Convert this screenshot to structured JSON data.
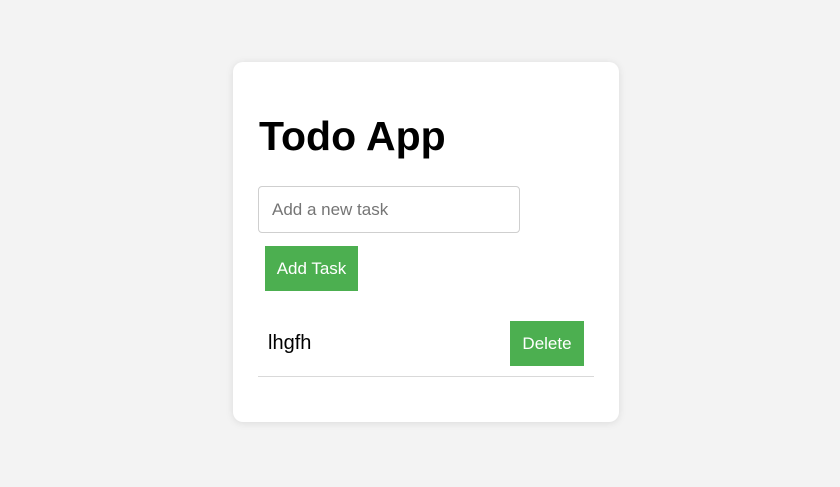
{
  "app": {
    "title": "Todo App"
  },
  "new_task": {
    "placeholder": "Add a new task",
    "value": ""
  },
  "buttons": {
    "add_label": "Add Task",
    "delete_label": "Delete"
  },
  "tasks": [
    {
      "text": "lhgfh"
    }
  ],
  "colors": {
    "page_background": "#f3f3f3",
    "card_background": "#ffffff",
    "accent": "#4caf50"
  }
}
